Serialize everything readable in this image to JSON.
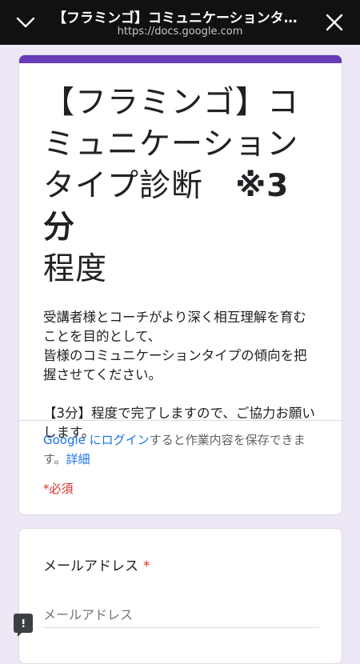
{
  "browser": {
    "title": "【フラミンゴ】コミュニケーションタイ…",
    "url": "https://docs.google.com"
  },
  "form": {
    "title": "【フラミンゴ】コミュニケーションタイプ診断",
    "title_note": "※3分",
    "title_end": "程度",
    "description": "受講者様とコーチがより深く相互理解を育むことを目的として、\n皆様のコミュニケーションタイプの傾向を把握させてください。\n\n【3分】程度で完了しますので、ご協力お願いします。",
    "login_link": "Google にログイン",
    "login_text": "すると作業内容を保存できます。",
    "details_link": "詳細",
    "required_note": "*必須"
  },
  "question": {
    "label": "メールアドレス",
    "required_mark": "*",
    "placeholder": "メールアドレス",
    "value": ""
  },
  "colors": {
    "accent": "#673ab7",
    "background": "#ede7f6",
    "required": "#d93025",
    "link": "#1a73e8"
  },
  "icons": {
    "left": "chevron-down-icon",
    "right": "close-icon",
    "feedback": "feedback-icon"
  }
}
